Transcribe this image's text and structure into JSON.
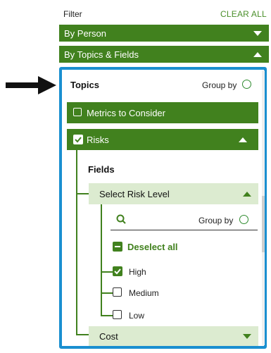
{
  "header": {
    "title": "Filter",
    "clear_all": "CLEAR ALL"
  },
  "sections": [
    {
      "label": "By Person",
      "expanded": false
    },
    {
      "label": "By Topics & Fields",
      "expanded": true
    }
  ],
  "topics": {
    "title": "Topics",
    "group_by": "Group by",
    "items": [
      {
        "label": "Metrics to Consider",
        "checked": false,
        "expanded": false
      },
      {
        "label": "Risks",
        "checked": true,
        "expanded": true
      }
    ]
  },
  "fields": {
    "title": "Fields",
    "items": [
      {
        "label": "Select Risk Level",
        "expanded": true
      },
      {
        "label": "Cost",
        "expanded": false
      }
    ]
  },
  "risk_level": {
    "search_placeholder": "",
    "group_by": "Group by",
    "deselect_all": "Deselect all",
    "options": [
      {
        "label": "High",
        "checked": true
      },
      {
        "label": "Medium",
        "checked": false
      },
      {
        "label": "Low",
        "checked": false
      }
    ]
  },
  "colors": {
    "primary_green": "#41811e",
    "light_green": "#dcebd0",
    "highlight_border": "#1a8fd0",
    "arrow": "#111111"
  },
  "icons": [
    "pointer-arrow-icon",
    "caret-down-icon",
    "caret-up-icon",
    "search-icon",
    "checkbox-checked-icon",
    "checkbox-empty-icon",
    "minus-icon",
    "radio-icon"
  ]
}
